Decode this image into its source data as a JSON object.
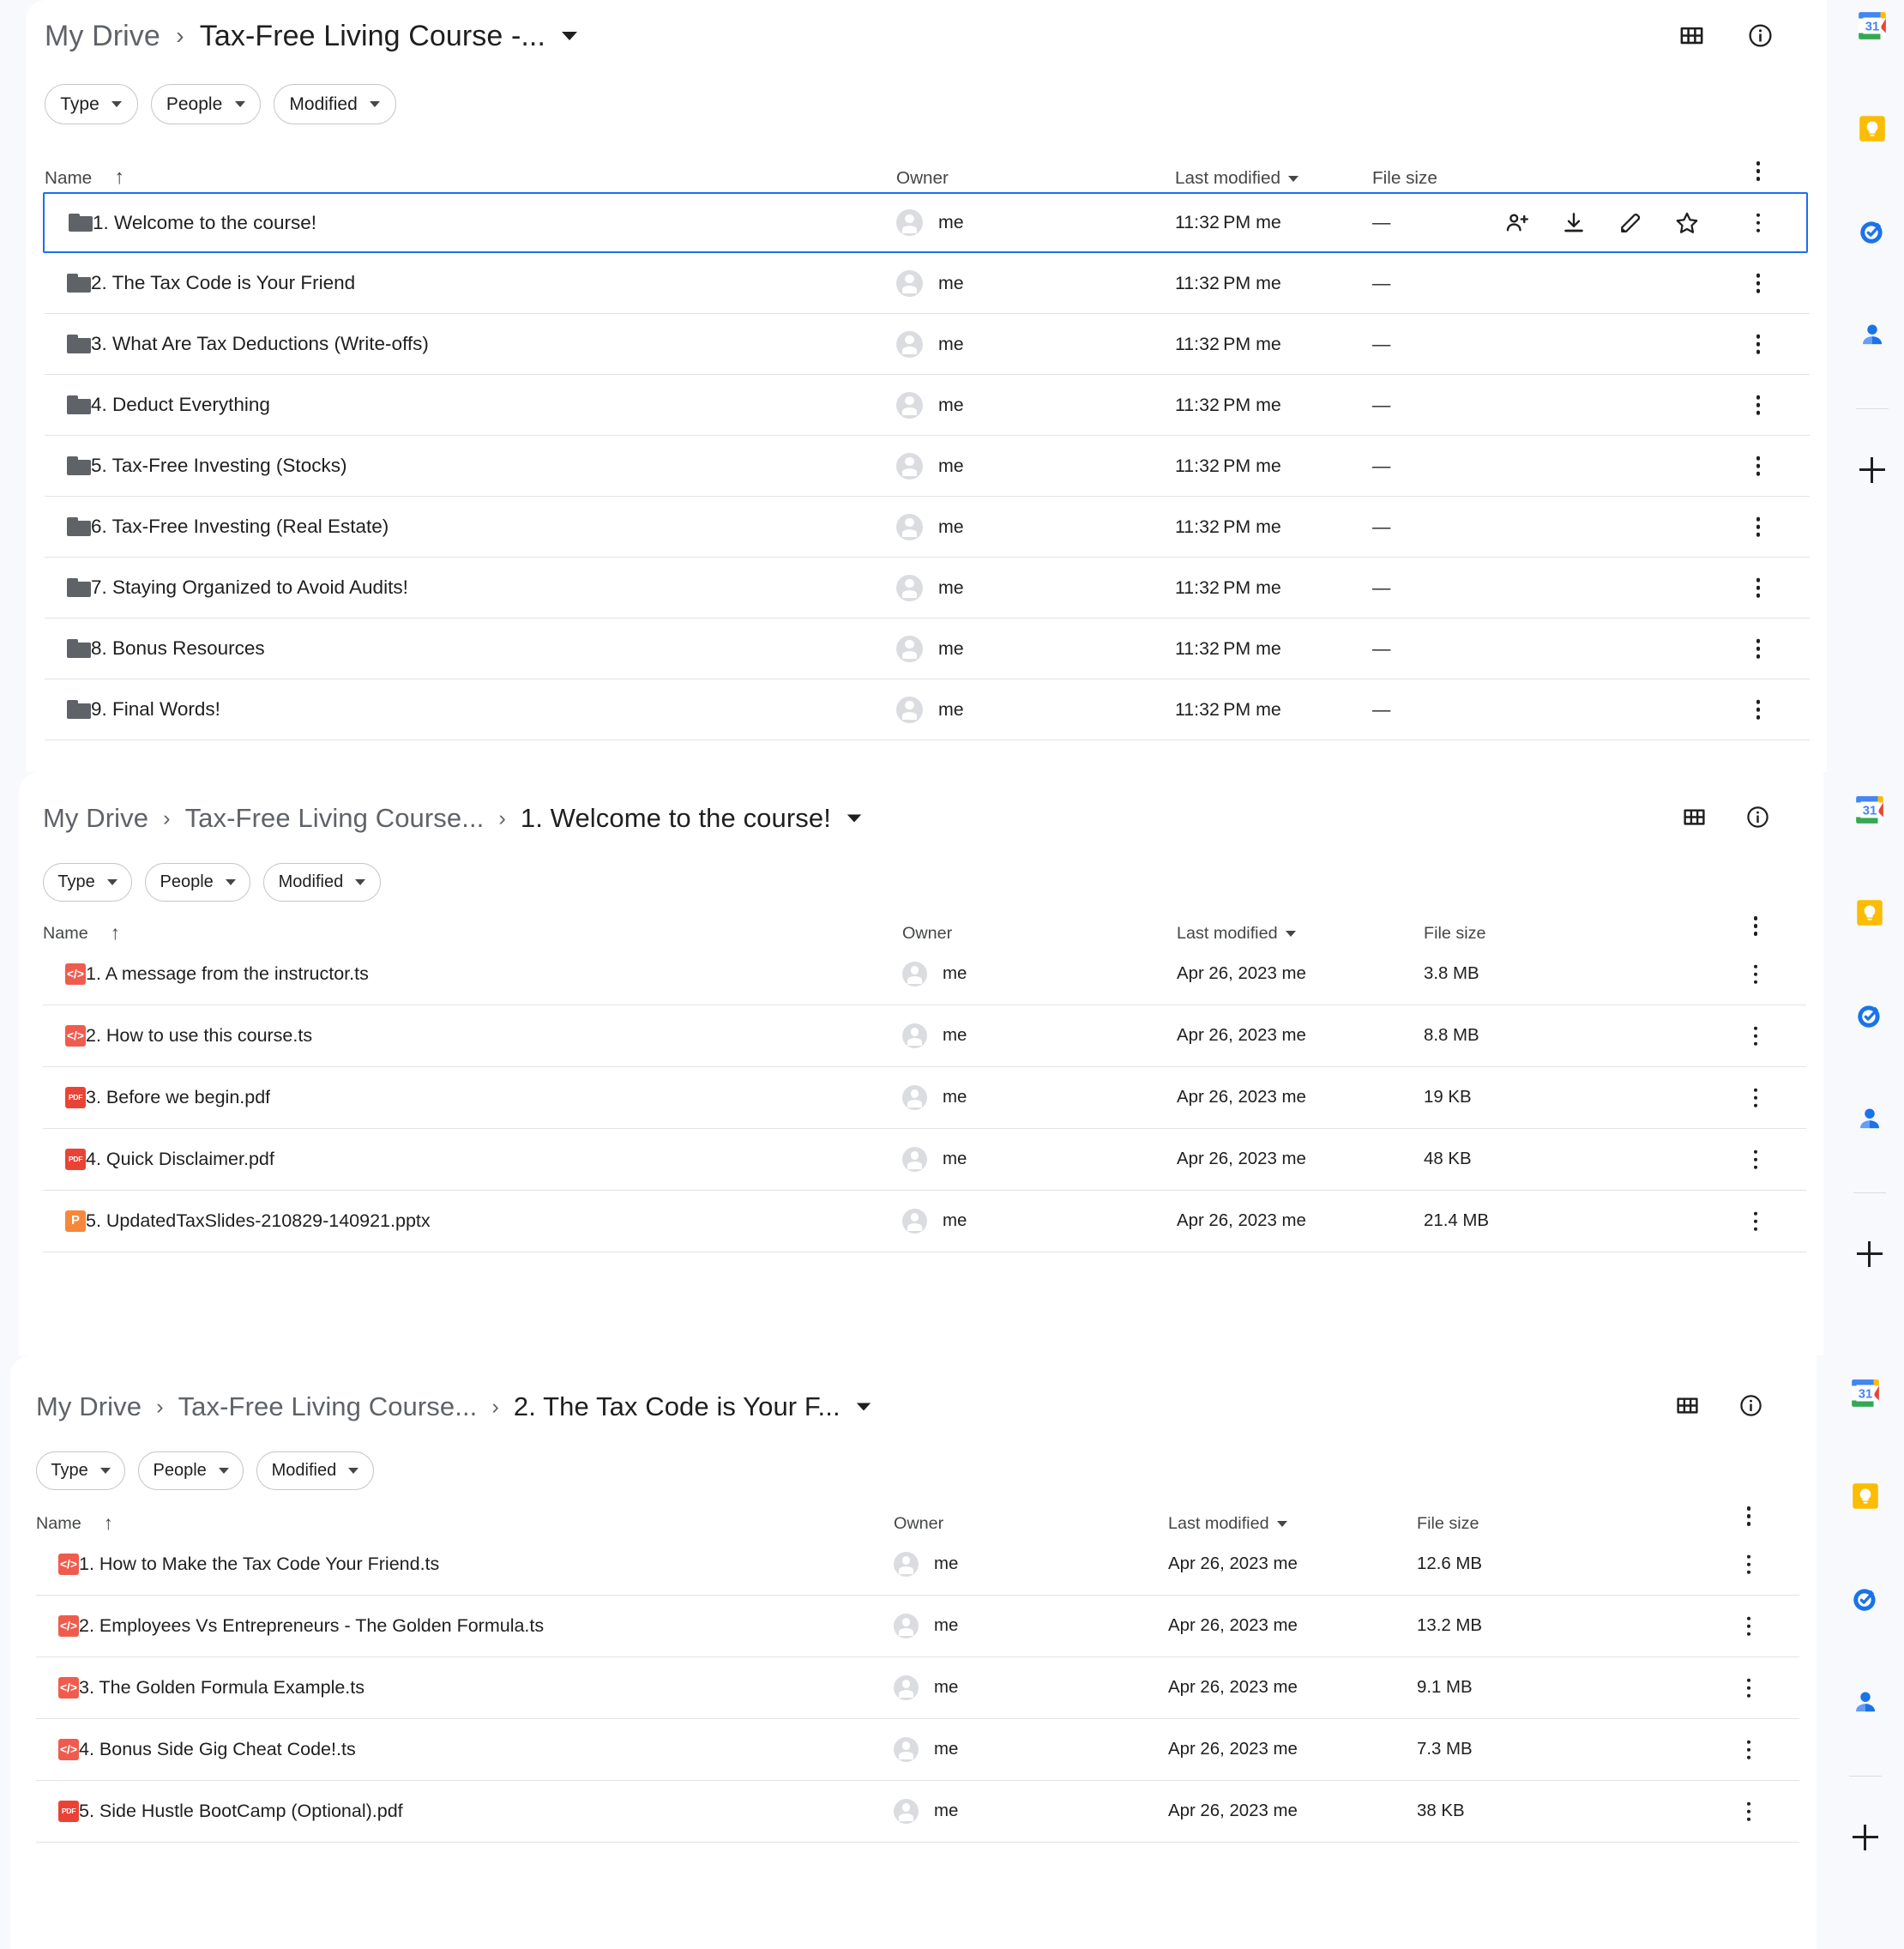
{
  "app": {
    "name": "Google Drive",
    "view": "list"
  },
  "colors": {
    "accent": "#1b6ef3",
    "page_bg": "#f8f9fd",
    "panel_bg": "#ffffff",
    "row_divider": "#e3e3e3",
    "muted_text": "#5f6368",
    "ts_icon": "#ef5c4e",
    "pdf_icon": "#ea4335",
    "pptx_icon": "#f6873b",
    "folder_icon": "#5f6368"
  },
  "common": {
    "chips": [
      {
        "label": "Type",
        "name": "type"
      },
      {
        "label": "People",
        "name": "people"
      },
      {
        "label": "Modified",
        "name": "modified"
      }
    ],
    "columns": {
      "name": "Name",
      "owner": "Owner",
      "last_modified": "Last modified",
      "file_size": "File size"
    },
    "sort": {
      "column": "Name",
      "direction": "ascending",
      "glyph": "↑"
    },
    "secondary_sort_indicator": "Last modified",
    "header_icons": [
      {
        "name": "grid-view-icon",
        "label": "Grid view"
      },
      {
        "name": "info-icon",
        "label": "View details"
      }
    ],
    "dash": "—",
    "owner_label": "me"
  },
  "side_rail": {
    "items": [
      {
        "name": "google-calendar-icon",
        "label": "Calendar",
        "day": "31"
      },
      {
        "name": "google-keep-icon",
        "label": "Keep"
      },
      {
        "name": "google-tasks-icon",
        "label": "Tasks"
      },
      {
        "name": "google-contacts-icon",
        "label": "Contacts"
      }
    ],
    "add": {
      "name": "add-apps-icon",
      "label": "Get add-ons",
      "glyph": "+"
    }
  },
  "panels": [
    {
      "id": "panel-1",
      "breadcrumb": [
        {
          "label": "My Drive",
          "current": false
        },
        {
          "label": "Tax-Free Living Course -...",
          "current": true
        }
      ],
      "rows": [
        {
          "icon": "folder",
          "name": "1. Welcome to the course!",
          "owner": "me",
          "modified": "11:32 PM me",
          "size": "—",
          "selected": true
        },
        {
          "icon": "folder",
          "name": "2. The Tax Code is Your Friend",
          "owner": "me",
          "modified": "11:32 PM me",
          "size": "—",
          "selected": false
        },
        {
          "icon": "folder",
          "name": "3. What Are Tax Deductions (Write-offs)",
          "owner": "me",
          "modified": "11:32 PM me",
          "size": "—",
          "selected": false
        },
        {
          "icon": "folder",
          "name": "4. Deduct Everything",
          "owner": "me",
          "modified": "11:32 PM me",
          "size": "—",
          "selected": false
        },
        {
          "icon": "folder",
          "name": "5. Tax-Free Investing (Stocks)",
          "owner": "me",
          "modified": "11:32 PM me",
          "size": "—",
          "selected": false
        },
        {
          "icon": "folder",
          "name": "6. Tax-Free Investing (Real Estate)",
          "owner": "me",
          "modified": "11:32 PM me",
          "size": "—",
          "selected": false
        },
        {
          "icon": "folder",
          "name": "7. Staying Organized to Avoid Audits!",
          "owner": "me",
          "modified": "11:32 PM me",
          "size": "—",
          "selected": false
        },
        {
          "icon": "folder",
          "name": "8. Bonus Resources",
          "owner": "me",
          "modified": "11:32 PM me",
          "size": "—",
          "selected": false
        },
        {
          "icon": "folder",
          "name": "9. Final Words!",
          "owner": "me",
          "modified": "11:32 PM me",
          "size": "—",
          "selected": false
        }
      ],
      "row_actions": [
        {
          "name": "share-icon",
          "label": "Share"
        },
        {
          "name": "download-icon",
          "label": "Download"
        },
        {
          "name": "rename-icon",
          "label": "Rename"
        },
        {
          "name": "star-icon",
          "label": "Add to starred"
        },
        {
          "name": "more-actions-icon",
          "label": "More actions"
        }
      ]
    },
    {
      "id": "panel-2",
      "breadcrumb": [
        {
          "label": "My Drive",
          "current": false
        },
        {
          "label": "Tax-Free Living Course...",
          "current": false
        },
        {
          "label": "1. Welcome to the course!",
          "current": true
        }
      ],
      "rows": [
        {
          "icon": "ts",
          "name": "1. A message from the instructor.ts",
          "owner": "me",
          "modified": "Apr 26, 2023 me",
          "size": "3.8 MB",
          "selected": false
        },
        {
          "icon": "ts",
          "name": "2. How to use this course.ts",
          "owner": "me",
          "modified": "Apr 26, 2023 me",
          "size": "8.8 MB",
          "selected": false
        },
        {
          "icon": "pdf",
          "name": "3. Before we begin.pdf",
          "owner": "me",
          "modified": "Apr 26, 2023 me",
          "size": "19 KB",
          "selected": false
        },
        {
          "icon": "pdf",
          "name": "4. Quick Disclaimer.pdf",
          "owner": "me",
          "modified": "Apr 26, 2023 me",
          "size": "48 KB",
          "selected": false
        },
        {
          "icon": "ppt",
          "name": "5. UpdatedTaxSlides-210829-140921.pptx",
          "owner": "me",
          "modified": "Apr 26, 2023 me",
          "size": "21.4 MB",
          "selected": false
        }
      ]
    },
    {
      "id": "panel-3",
      "breadcrumb": [
        {
          "label": "My Drive",
          "current": false
        },
        {
          "label": "Tax-Free Living Course...",
          "current": false
        },
        {
          "label": "2. The Tax Code is Your F...",
          "current": true
        }
      ],
      "rows": [
        {
          "icon": "ts",
          "name": "1. How to Make the Tax Code Your Friend.ts",
          "owner": "me",
          "modified": "Apr 26, 2023 me",
          "size": "12.6 MB",
          "selected": false
        },
        {
          "icon": "ts",
          "name": "2. Employees Vs Entrepreneurs - The Golden Formula.ts",
          "owner": "me",
          "modified": "Apr 26, 2023 me",
          "size": "13.2 MB",
          "selected": false
        },
        {
          "icon": "ts",
          "name": "3. The Golden Formula Example.ts",
          "owner": "me",
          "modified": "Apr 26, 2023 me",
          "size": "9.1 MB",
          "selected": false
        },
        {
          "icon": "ts",
          "name": "4. Bonus Side Gig Cheat Code!.ts",
          "owner": "me",
          "modified": "Apr 26, 2023 me",
          "size": "7.3 MB",
          "selected": false
        },
        {
          "icon": "pdf",
          "name": "5. Side Hustle BootCamp (Optional).pdf",
          "owner": "me",
          "modified": "Apr 26, 2023 me",
          "size": "38 KB",
          "selected": false
        }
      ]
    }
  ],
  "file_type_labels": {
    "ts": "</>",
    "pdf": "PDF",
    "ppt": "P"
  }
}
